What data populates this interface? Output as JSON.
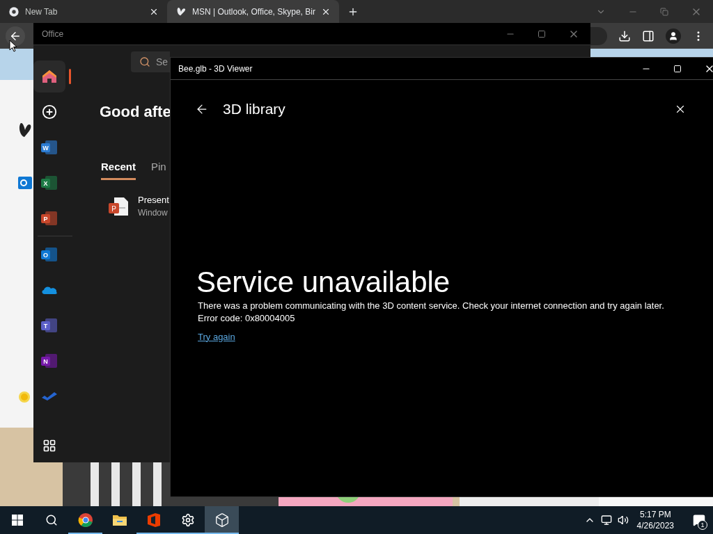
{
  "browser": {
    "tabs": [
      {
        "title": "New Tab",
        "selected": false
      },
      {
        "title": "MSN | Outlook, Office, Skype, Bir",
        "selected": true
      }
    ]
  },
  "office": {
    "title": "Office",
    "search": {
      "placeholder": "Se"
    },
    "greeting": "Good afte",
    "nav": [
      {
        "label": "Recent",
        "selected": true
      },
      {
        "label": "Pin",
        "selected": false
      }
    ],
    "file": {
      "letter": "P",
      "name": "Present",
      "location": "Window"
    },
    "apps": [
      {
        "kind": "home",
        "selected": true
      },
      {
        "kind": "new",
        "selected": false
      },
      {
        "kind": "app",
        "letter": "W",
        "color": "#2b7cd3",
        "selected": false
      },
      {
        "kind": "app",
        "letter": "X",
        "color": "#1d7a45",
        "selected": false
      },
      {
        "kind": "app",
        "letter": "P",
        "color": "#c8472b",
        "selected": false
      },
      {
        "kind": "divider"
      },
      {
        "kind": "app",
        "letter": "O",
        "color": "#0f78d4",
        "selected": false
      },
      {
        "kind": "cloud",
        "color": "#1490df",
        "selected": false
      },
      {
        "kind": "app",
        "letter": "T",
        "color": "#5b5fc7",
        "selected": false
      },
      {
        "kind": "app",
        "letter": "N",
        "color": "#7719aa",
        "selected": false
      },
      {
        "kind": "check",
        "color": "#2564cf",
        "selected": false
      }
    ]
  },
  "viewer": {
    "title": "Bee.glb - 3D Viewer",
    "heading": "3D library",
    "error": {
      "title": "Service unavailable",
      "message": "There was a problem communicating with the 3D content service. Check your internet connection and try again later.",
      "code": "Error code: 0x80004005",
      "link": "Try again"
    }
  },
  "taskbar": {
    "apps": [
      {
        "kind": "start",
        "selected": false,
        "running": false
      },
      {
        "kind": "search",
        "selected": false,
        "running": false
      },
      {
        "kind": "chrome",
        "selected": false,
        "running": true
      },
      {
        "kind": "folder",
        "selected": false,
        "running": false
      },
      {
        "kind": "office",
        "selected": false,
        "running": true
      },
      {
        "kind": "settings",
        "selected": false,
        "running": true
      },
      {
        "kind": "viewer",
        "selected": true,
        "running": true
      }
    ],
    "time": "5:17 PM",
    "date": "4/26/2023",
    "notifications": "1"
  }
}
